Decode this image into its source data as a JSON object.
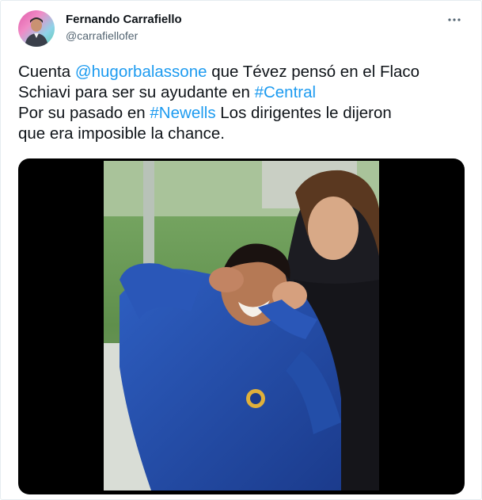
{
  "tweet": {
    "author_name": "Fernando Carrafiello",
    "author_handle": "@carrafiellofer",
    "more_icon": "more-dots-icon",
    "lines": [
      [
        {
          "t": "Cuenta "
        },
        {
          "t": "@hugorbalassone",
          "link": true
        },
        {
          "t": " que Tévez pensó en el Flaco"
        }
      ],
      [
        {
          "t": "Schiavi para ser su ayudante en "
        },
        {
          "t": "#Central",
          "link": true
        }
      ],
      [
        {
          "t": "Por su pasado en "
        },
        {
          "t": "#Newells",
          "link": true
        },
        {
          "t": " Los dirigentes le dijeron"
        }
      ],
      [
        {
          "t": "que era imposible la chance."
        }
      ]
    ],
    "link_color": "#1d9bf0"
  },
  "media": {
    "type": "photo",
    "subject": "two footballers, one in blue jersey with fingers in ears, another behind him"
  }
}
